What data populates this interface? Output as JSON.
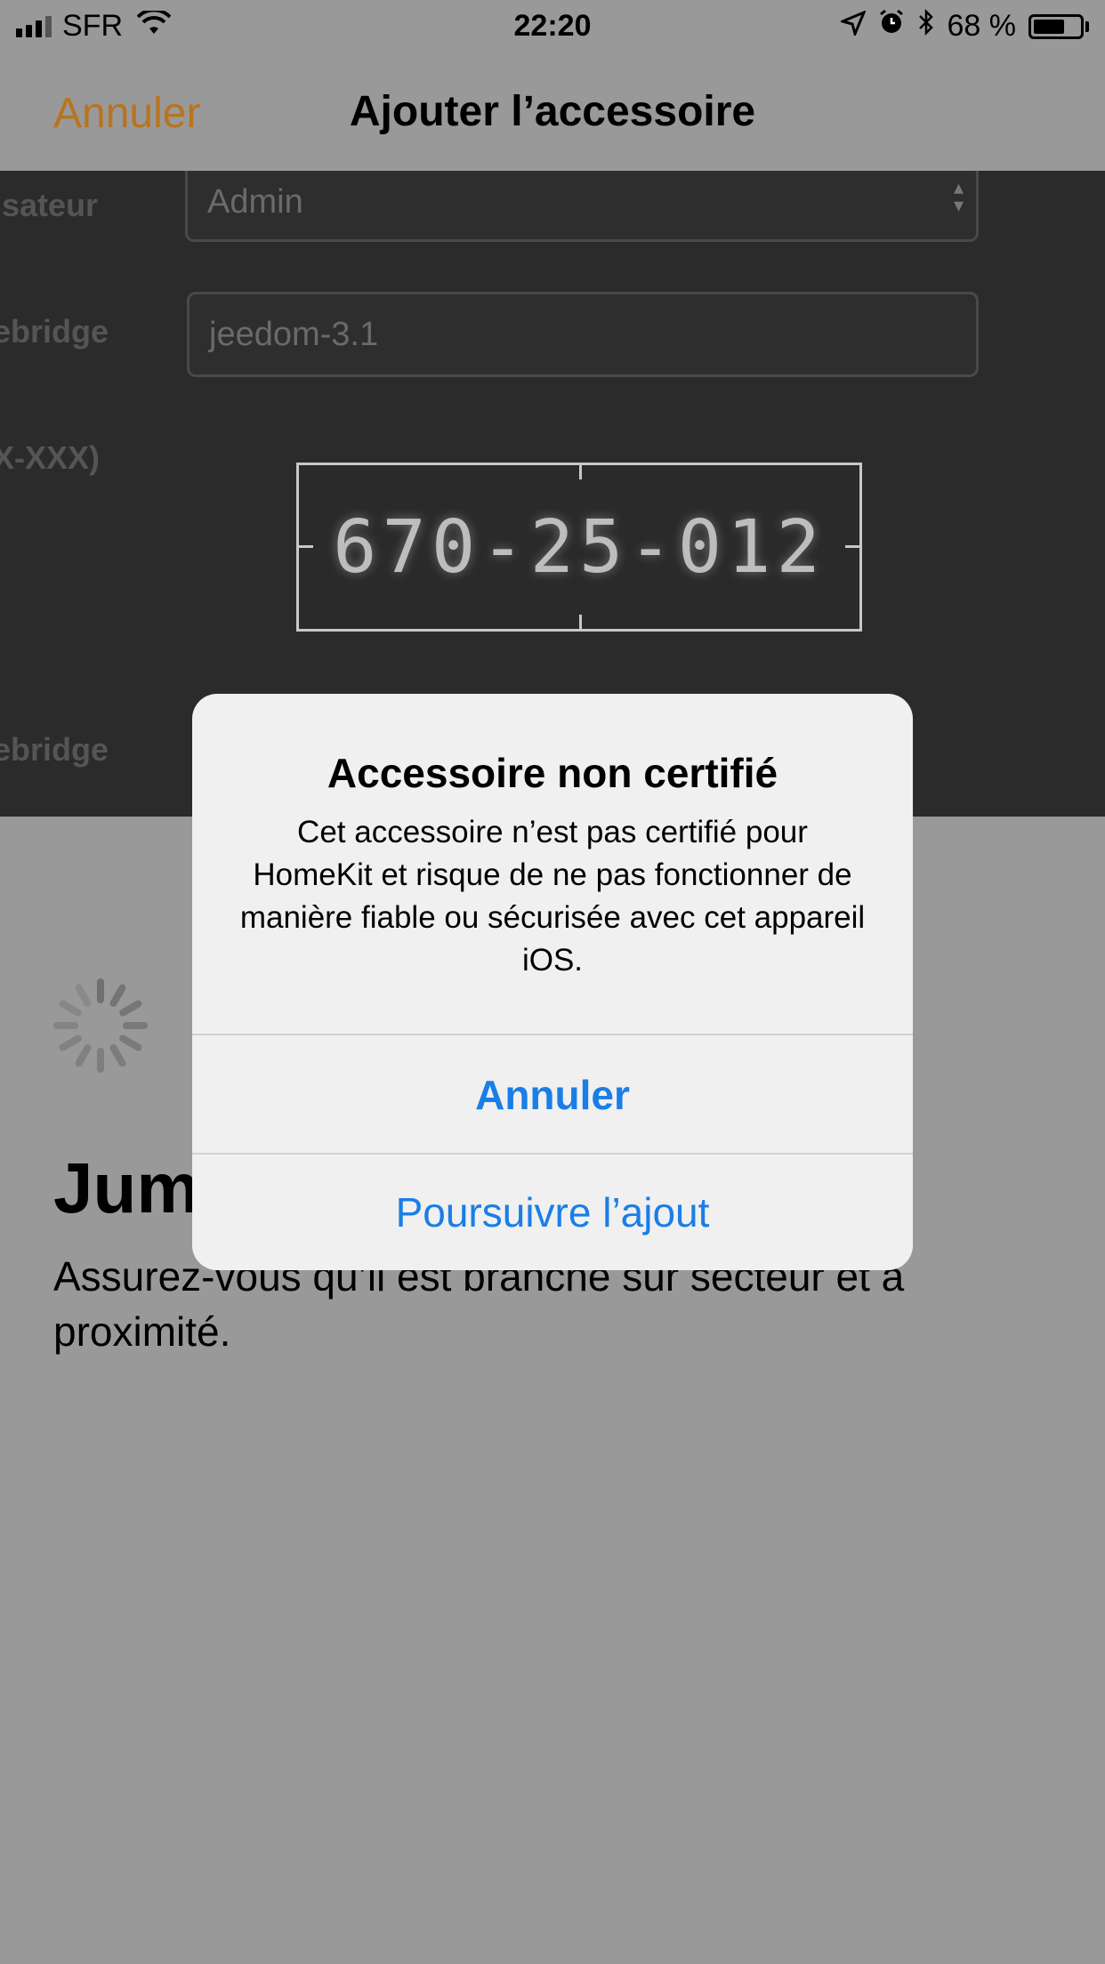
{
  "status_bar": {
    "carrier": "SFR",
    "time": "22:20",
    "battery_text": "68 %",
    "battery_level": 0.68,
    "icons": [
      "signal-icon",
      "wifi-icon",
      "location-icon",
      "alarm-icon",
      "bluetooth-icon",
      "battery-icon"
    ]
  },
  "nav": {
    "cancel_label": "Annuler",
    "title": "Ajouter l’accessoire",
    "accent_color": "#B8741E"
  },
  "camera": {
    "labels": [
      "isateur",
      "ebridge",
      "X-XXX)",
      "ebridge"
    ],
    "user_field_value": "Admin",
    "bridge_field_value": "jeedom-3.1",
    "setup_code": "670-25-012"
  },
  "background": {
    "headline": "Jum",
    "instructions": "Assurez-vous qu’il est branché sur secteur et à proximité."
  },
  "alert": {
    "title": "Accessoire non certifié",
    "message": "Cet accessoire n’est pas certifié pour HomeKit et risque de ne pas fonctionner de manière fiable ou sécurisée avec cet appareil iOS.",
    "cancel_label": "Annuler",
    "continue_label": "Poursuivre l’ajout",
    "button_color": "#1a7ee6"
  }
}
